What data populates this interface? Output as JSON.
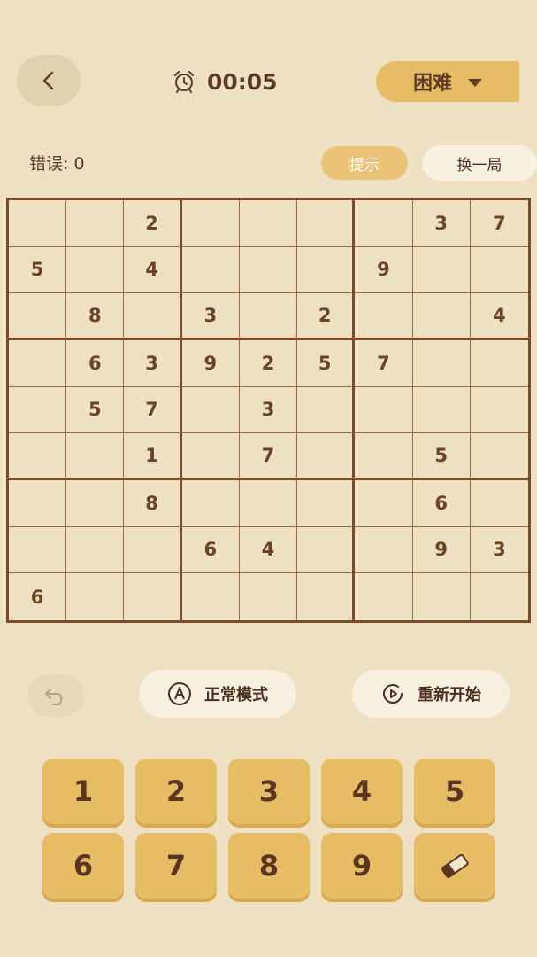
{
  "header": {
    "timer": "00:05",
    "difficulty": "困难"
  },
  "info": {
    "errors": "错误: 0",
    "hint": "提示",
    "new_game": "换一局"
  },
  "board": [
    [
      "",
      "",
      "2",
      "",
      "",
      "",
      "",
      "3",
      "7"
    ],
    [
      "5",
      "",
      "4",
      "",
      "",
      "",
      "9",
      "",
      ""
    ],
    [
      "",
      "8",
      "",
      "3",
      "",
      "2",
      "",
      "",
      "4"
    ],
    [
      "",
      "6",
      "3",
      "9",
      "2",
      "5",
      "7",
      "",
      ""
    ],
    [
      "",
      "5",
      "7",
      "",
      "3",
      "",
      "",
      "",
      ""
    ],
    [
      "",
      "",
      "1",
      "",
      "7",
      "",
      "",
      "5",
      ""
    ],
    [
      "",
      "",
      "8",
      "",
      "",
      "",
      "",
      "6",
      ""
    ],
    [
      "",
      "",
      "",
      "6",
      "4",
      "",
      "",
      "9",
      "3"
    ],
    [
      "6",
      "",
      "",
      "",
      "",
      "",
      "",
      "",
      ""
    ]
  ],
  "actions": {
    "mode": "正常模式",
    "restart": "重新开始"
  },
  "keypad": {
    "digits": [
      "1",
      "2",
      "3",
      "4",
      "5",
      "6",
      "7",
      "8",
      "9"
    ],
    "eraser_icon": "eraser-icon"
  },
  "colors": {
    "background": "#ede0c3",
    "accent": "#e6bc65",
    "grid": "#7a4b2a",
    "text": "#6b4426"
  }
}
